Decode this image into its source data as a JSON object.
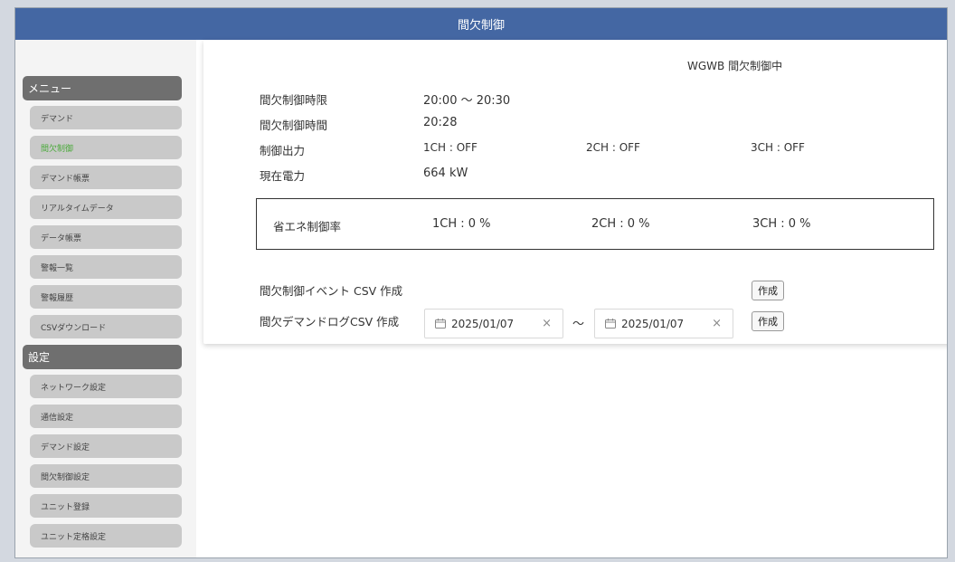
{
  "title": "間欠制御",
  "sidebar": {
    "menu_header": "メニュー",
    "menu_items": [
      {
        "label": "デマンド",
        "active": false
      },
      {
        "label": "間欠制御",
        "active": true
      },
      {
        "label": "デマンド帳票",
        "active": false
      },
      {
        "label": "リアルタイムデータ",
        "active": false
      },
      {
        "label": "データ帳票",
        "active": false
      },
      {
        "label": "警報一覧",
        "active": false
      },
      {
        "label": "警報履歴",
        "active": false
      },
      {
        "label": "CSVダウンロード",
        "active": false
      }
    ],
    "settings_header": "設定",
    "settings_items": [
      {
        "label": "ネットワーク設定"
      },
      {
        "label": "通信設定"
      },
      {
        "label": "デマンド設定"
      },
      {
        "label": "間欠制御設定"
      },
      {
        "label": "ユニット登録"
      },
      {
        "label": "ユニット定格設定"
      }
    ]
  },
  "main": {
    "status": "WGWB 間欠制御中",
    "time_limit_label": "間欠制御時限",
    "time_limit_value": "20:00 ～ 20:30",
    "time_label": "間欠制御時間",
    "time_value": "20:28",
    "output_label": "制御出力",
    "outputs": [
      "1CH : OFF",
      "2CH : OFF",
      "3CH : OFF"
    ],
    "power_label": "現在電力",
    "power_value": "664 kW",
    "rate_label": "省エネ制御率",
    "rates": [
      "1CH : 0 %",
      "2CH : 0 %",
      "3CH : 0 %"
    ],
    "event_csv_label": "間欠制御イベント CSV 作成",
    "demand_csv_label": "間欠デマンドログCSV 作成",
    "create_button": "作成",
    "date_from": "2025/01/07",
    "date_to": "2025/01/07",
    "range_separator": "～",
    "clear_symbol": "×"
  }
}
